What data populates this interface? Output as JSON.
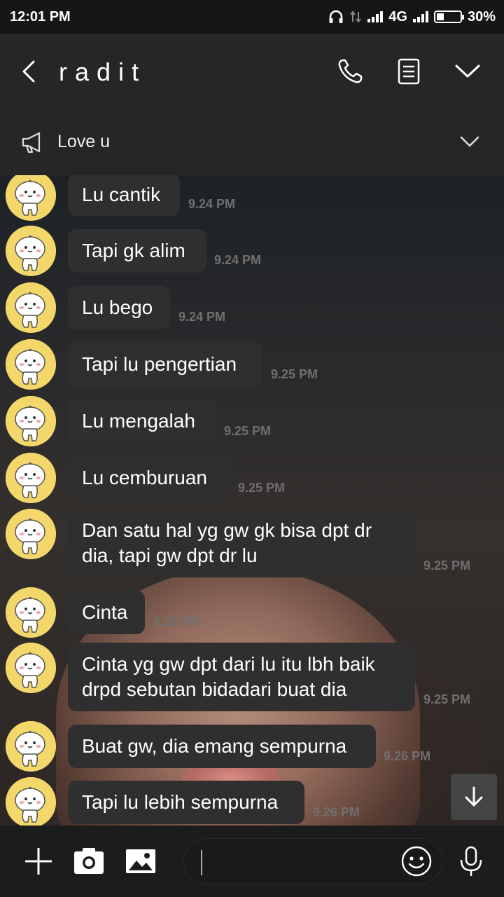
{
  "status_bar": {
    "time": "12:01 PM",
    "network": "4G",
    "battery": "30%",
    "battery_level": 0.3
  },
  "header": {
    "title": "radit",
    "icons": [
      "back-icon",
      "phone-icon",
      "notes-icon",
      "chevron-down-icon"
    ]
  },
  "notice": {
    "text": "Love u",
    "icons": [
      "megaphone-icon",
      "chevron-down-icon"
    ]
  },
  "messages": [
    {
      "text": "Lu cantik",
      "time": "9.24 PM"
    },
    {
      "text": "Tapi gk alim",
      "time": "9.24 PM"
    },
    {
      "text": "Lu bego",
      "time": "9.24 PM"
    },
    {
      "text": "Tapi lu pengertian",
      "time": "9.25 PM"
    },
    {
      "text": "Lu mengalah",
      "time": "9.25 PM"
    },
    {
      "text": "Lu cemburuan",
      "time": "9.25 PM"
    },
    {
      "text": "Dan satu hal yg gw gk bisa dpt dr dia, tapi gw dpt dr lu",
      "time": "9.25 PM"
    },
    {
      "text": "Cinta",
      "time": "9.25 PM"
    },
    {
      "text": "Cinta yg gw dpt dari lu itu lbh baik drpd sebutan bidadari buat dia",
      "time": "9.25 PM"
    },
    {
      "text": "Buat gw, dia emang sempurna",
      "time": "9.26 PM"
    },
    {
      "text": "Tapi lu lebih sempurna",
      "time": "9.26 PM"
    }
  ],
  "input_bar": {
    "icons": [
      "plus-icon",
      "camera-icon",
      "image-icon",
      "emoji-icon",
      "microphone-icon"
    ]
  },
  "colors": {
    "bubble": "#2f2f30",
    "avatar": "#f3d76b",
    "timestamp": "#6f6f6f",
    "header": "#262626"
  }
}
